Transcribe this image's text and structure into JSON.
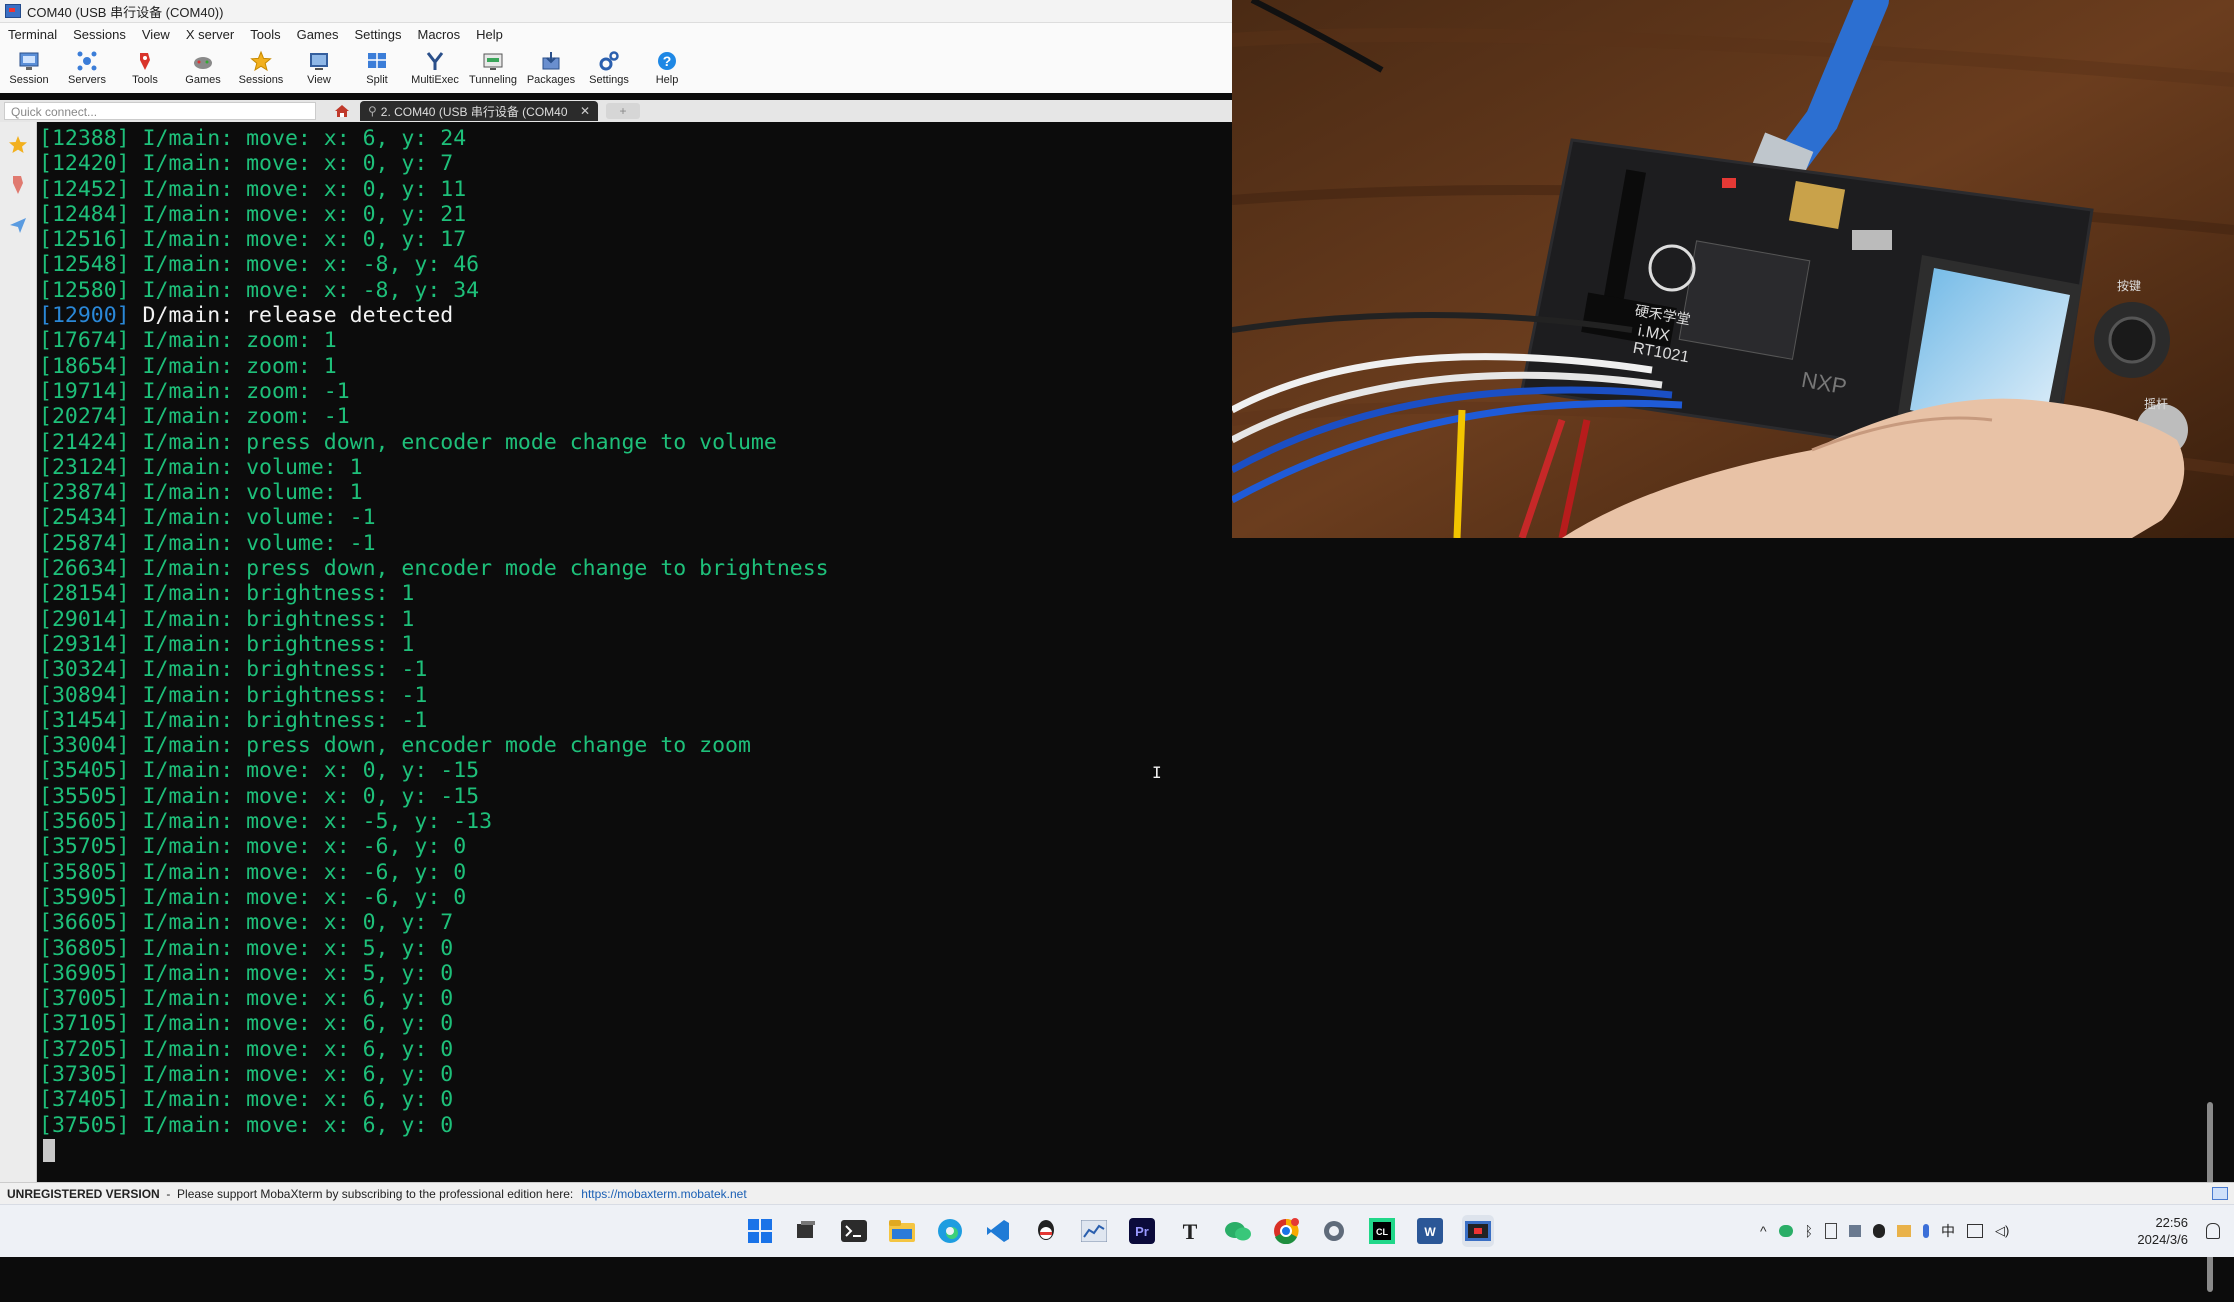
{
  "window": {
    "title": "COM40  (USB 串行设备 (COM40))"
  },
  "menu": [
    "Terminal",
    "Sessions",
    "View",
    "X server",
    "Tools",
    "Games",
    "Settings",
    "Macros",
    "Help"
  ],
  "toolbar": {
    "buttons": [
      {
        "label": "Session",
        "icon": "session-icon"
      },
      {
        "label": "Servers",
        "icon": "servers-icon"
      },
      {
        "label": "Tools",
        "icon": "tools-icon"
      },
      {
        "label": "Games",
        "icon": "games-icon"
      },
      {
        "label": "Sessions",
        "icon": "star-icon"
      },
      {
        "label": "View",
        "icon": "view-icon"
      },
      {
        "label": "Split",
        "icon": "split-icon"
      },
      {
        "label": "MultiExec",
        "icon": "multiexec-icon"
      },
      {
        "label": "Tunneling",
        "icon": "tunneling-icon"
      },
      {
        "label": "Packages",
        "icon": "packages-icon"
      },
      {
        "label": "Settings",
        "icon": "gear-icon"
      },
      {
        "label": "Help",
        "icon": "help-icon"
      }
    ]
  },
  "quick_connect": {
    "placeholder": "Quick connect..."
  },
  "tabs": {
    "session_tab": "2. COM40  (USB 串行设备 (COM40",
    "close": "✕",
    "new_tab": "+"
  },
  "terminal": {
    "lines": [
      {
        "ts": "[12388]",
        "msg": " I/main: move: x: 6, y: 24",
        "level": "info"
      },
      {
        "ts": "[12420]",
        "msg": " I/main: move: x: 0, y: 7",
        "level": "info"
      },
      {
        "ts": "[12452]",
        "msg": " I/main: move: x: 0, y: 11",
        "level": "info"
      },
      {
        "ts": "[12484]",
        "msg": " I/main: move: x: 0, y: 21",
        "level": "info"
      },
      {
        "ts": "[12516]",
        "msg": " I/main: move: x: 0, y: 17",
        "level": "info"
      },
      {
        "ts": "[12548]",
        "msg": " I/main: move: x: -8, y: 46",
        "level": "info"
      },
      {
        "ts": "[12580]",
        "msg": " I/main: move: x: -8, y: 34",
        "level": "info"
      },
      {
        "ts": "[12900]",
        "msg": " D/main: release detected",
        "level": "debug"
      },
      {
        "ts": "[17674]",
        "msg": " I/main: zoom: 1",
        "level": "info"
      },
      {
        "ts": "[18654]",
        "msg": " I/main: zoom: 1",
        "level": "info"
      },
      {
        "ts": "[19714]",
        "msg": " I/main: zoom: -1",
        "level": "info"
      },
      {
        "ts": "[20274]",
        "msg": " I/main: zoom: -1",
        "level": "info"
      },
      {
        "ts": "[21424]",
        "msg": " I/main: press down, encoder mode change to volume",
        "level": "info"
      },
      {
        "ts": "[23124]",
        "msg": " I/main: volume: 1",
        "level": "info"
      },
      {
        "ts": "[23874]",
        "msg": " I/main: volume: 1",
        "level": "info"
      },
      {
        "ts": "[25434]",
        "msg": " I/main: volume: -1",
        "level": "info"
      },
      {
        "ts": "[25874]",
        "msg": " I/main: volume: -1",
        "level": "info"
      },
      {
        "ts": "[26634]",
        "msg": " I/main: press down, encoder mode change to brightness",
        "level": "info"
      },
      {
        "ts": "[28154]",
        "msg": " I/main: brightness: 1",
        "level": "info"
      },
      {
        "ts": "[29014]",
        "msg": " I/main: brightness: 1",
        "level": "info"
      },
      {
        "ts": "[29314]",
        "msg": " I/main: brightness: 1",
        "level": "info"
      },
      {
        "ts": "[30324]",
        "msg": " I/main: brightness: -1",
        "level": "info"
      },
      {
        "ts": "[30894]",
        "msg": " I/main: brightness: -1",
        "level": "info"
      },
      {
        "ts": "[31454]",
        "msg": " I/main: brightness: -1",
        "level": "info"
      },
      {
        "ts": "[33004]",
        "msg": " I/main: press down, encoder mode change to zoom",
        "level": "info"
      },
      {
        "ts": "[35405]",
        "msg": " I/main: move: x: 0, y: -15",
        "level": "info"
      },
      {
        "ts": "[35505]",
        "msg": " I/main: move: x: 0, y: -15",
        "level": "info"
      },
      {
        "ts": "[35605]",
        "msg": " I/main: move: x: -5, y: -13",
        "level": "info"
      },
      {
        "ts": "[35705]",
        "msg": " I/main: move: x: -6, y: 0",
        "level": "info"
      },
      {
        "ts": "[35805]",
        "msg": " I/main: move: x: -6, y: 0",
        "level": "info"
      },
      {
        "ts": "[35905]",
        "msg": " I/main: move: x: -6, y: 0",
        "level": "info"
      },
      {
        "ts": "[36605]",
        "msg": " I/main: move: x: 0, y: 7",
        "level": "info"
      },
      {
        "ts": "[36805]",
        "msg": " I/main: move: x: 5, y: 0",
        "level": "info"
      },
      {
        "ts": "[36905]",
        "msg": " I/main: move: x: 5, y: 0",
        "level": "info"
      },
      {
        "ts": "[37005]",
        "msg": " I/main: move: x: 6, y: 0",
        "level": "info"
      },
      {
        "ts": "[37105]",
        "msg": " I/main: move: x: 6, y: 0",
        "level": "info"
      },
      {
        "ts": "[37205]",
        "msg": " I/main: move: x: 6, y: 0",
        "level": "info"
      },
      {
        "ts": "[37305]",
        "msg": " I/main: move: x: 6, y: 0",
        "level": "info"
      },
      {
        "ts": "[37405]",
        "msg": " I/main: move: x: 6, y: 0",
        "level": "info"
      },
      {
        "ts": "[37505]",
        "msg": " I/main: move: x: 6, y: 0",
        "level": "info"
      }
    ],
    "colors": {
      "info": "#1ec07a",
      "debug_ts": "#2a88d8",
      "debug_msg": "#f2f2f2"
    }
  },
  "photo": {
    "board_text": [
      "硬禾学堂",
      "i.MX",
      "RT1021",
      "NXP",
      "按键",
      "摇杆"
    ]
  },
  "status": {
    "unregistered": "UNREGISTERED VERSION",
    "message": "  -  Please support MobaXterm by subscribing to the professional edition here:",
    "link": "https://mobaxterm.mobatek.net"
  },
  "taskbar": {
    "apps": [
      "windows-start-icon",
      "task-view-icon",
      "terminal-icon",
      "file-explorer-icon",
      "edge-icon",
      "vscode-icon",
      "qq-icon",
      "chart-app-icon",
      "premiere-icon",
      "typora-icon",
      "wechat-icon",
      "chrome-icon",
      "settings-icon",
      "clion-icon",
      "word-icon",
      "mobaxterm-icon"
    ],
    "tray": {
      "ime": "中"
    },
    "time": "22:56",
    "date": "2024/3/6"
  }
}
